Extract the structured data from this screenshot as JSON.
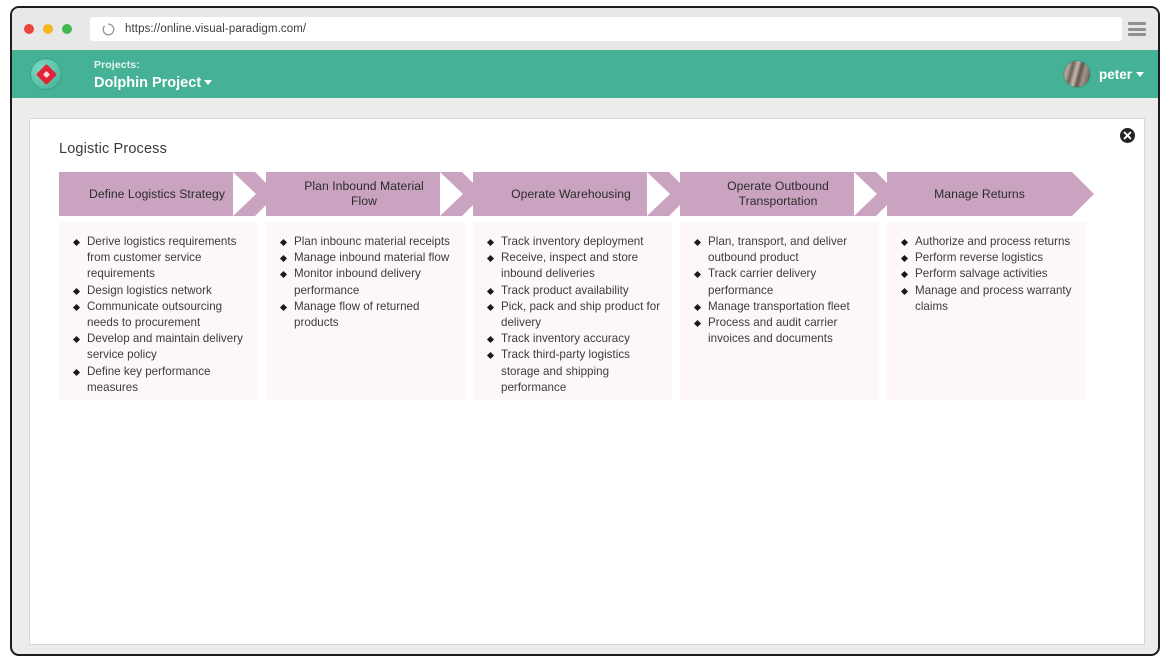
{
  "browser": {
    "url": "https://online.visual-paradigm.com/",
    "reload_icon": "reload-spinner-icon",
    "menu_icon": "hamburger-menu-icon",
    "traffic_lights": [
      "close-red",
      "minimize-yellow",
      "maximize-green"
    ]
  },
  "app_header": {
    "logo_icon": "visual-paradigm-logo-icon",
    "projects_label": "Projects:",
    "project_name": "Dolphin Project",
    "project_caret_icon": "chevron-down-icon",
    "user_name": "peter",
    "user_caret_icon": "chevron-down-icon",
    "avatar_icon": "user-avatar",
    "background_color": "#45b195"
  },
  "content": {
    "title": "Logistic Process",
    "close_icon": "close-circle-icon",
    "chevron_color": "#c9a3bf",
    "panel_color": "#fdf6fa"
  },
  "process": {
    "stages": [
      {
        "title": "Define Logistics Strategy",
        "items": [
          "Derive logistics requirements from customer service requirements",
          "Design logistics network",
          "Communicate outsourcing needs to procurement",
          "Develop and maintain delivery service policy",
          "Define key performance measures"
        ]
      },
      {
        "title": "Plan Inbound Material Flow",
        "items": [
          "Plan inbounc material receipts",
          "Manage inbound material flow",
          "Monitor inbound delivery performance",
          "Manage flow of returned products"
        ]
      },
      {
        "title": "Operate Warehousing",
        "items": [
          "Track inventory deployment",
          "Receive, inspect and store inbound deliveries",
          "Track product availability",
          "Pick, pack and ship product for delivery",
          "Track inventory accuracy",
          "Track third-party logistics storage and shipping performance"
        ]
      },
      {
        "title": "Operate Outbound Transportation",
        "items": [
          "Plan, transport, and deliver outbound product",
          "Track carrier delivery performance",
          "Manage transportation fleet",
          "Process and audit carrier invoices and documents"
        ]
      },
      {
        "title": "Manage Returns",
        "items": [
          "Authorize and process returns",
          "Perform reverse logistics",
          "Perform salvage activities",
          "Manage and process warranty claims"
        ]
      }
    ]
  }
}
